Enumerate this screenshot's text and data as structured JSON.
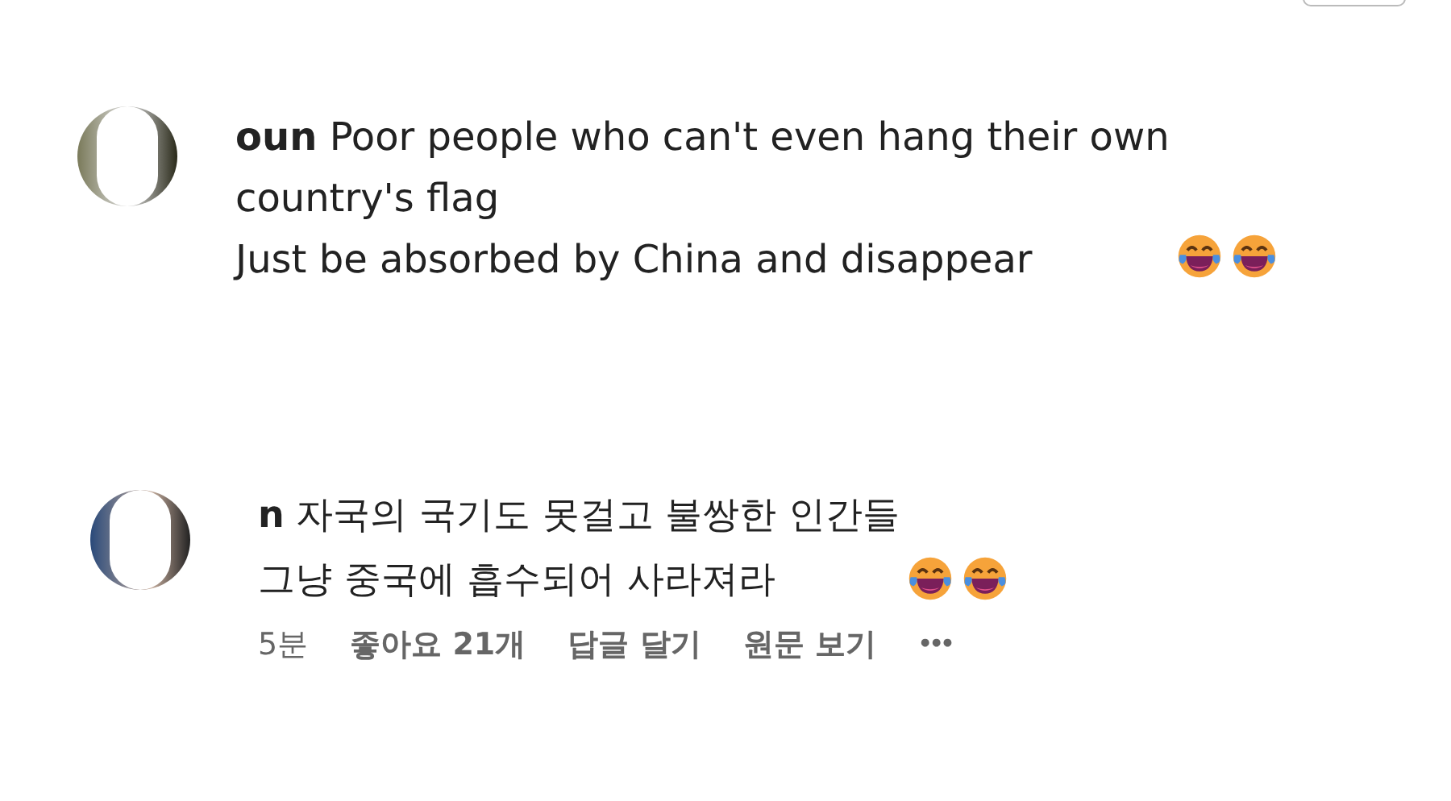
{
  "comments": [
    {
      "author": "oun",
      "lines": [
        "Poor people who can't even hang their own",
        "country's flag",
        "Just be absorbed by China and disappear"
      ],
      "emojis": [
        {
          "kind": "laughing-crying"
        },
        {
          "kind": "laughing-crying"
        }
      ]
    },
    {
      "author": "n",
      "lines": [
        "자국의 국기도 못걸고 불쌍한 인간들",
        "그냥 중국에 흡수되어 사라져라"
      ],
      "emojis": [
        {
          "kind": "laughing-crying"
        },
        {
          "kind": "laughing-crying"
        }
      ],
      "meta": {
        "time": "5분",
        "likes": "좋아요 21개",
        "actions": [
          "답글 달기",
          "원문 보기"
        ],
        "more": "•••"
      }
    }
  ]
}
